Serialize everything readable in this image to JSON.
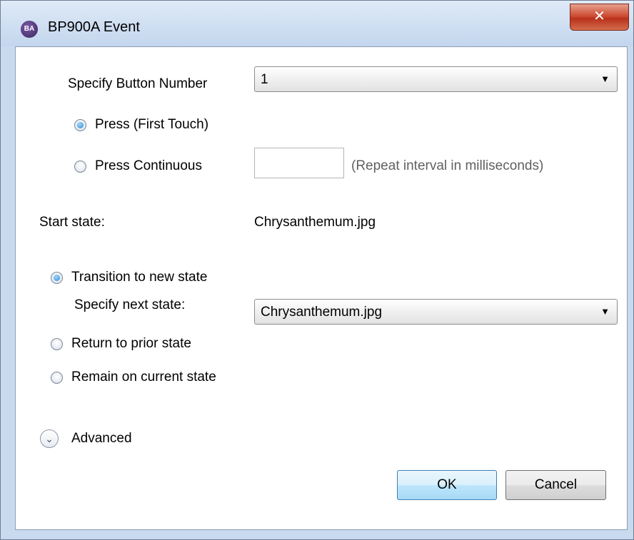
{
  "window": {
    "title": "BP900A Event",
    "icon_text": "BA",
    "close_glyph": "✕"
  },
  "button_number": {
    "label": "Specify Button Number",
    "value": "1",
    "arrow": "▼"
  },
  "press_mode": {
    "first_touch_label": "Press (First Touch)",
    "continuous_label": "Press Continuous",
    "selected": "first_touch",
    "interval_value": "",
    "interval_hint": "(Repeat interval in milliseconds)"
  },
  "start_state": {
    "label": "Start state:",
    "value": "Chrysanthemum.jpg"
  },
  "action": {
    "transition_label": "Transition to new state",
    "next_state_label": "Specify next state:",
    "next_state_value": "Chrysanthemum.jpg",
    "next_state_arrow": "▼",
    "return_label": "Return to prior state",
    "remain_label": "Remain on current state",
    "selected": "transition"
  },
  "advanced": {
    "label": "Advanced",
    "icon_glyph": "⌄"
  },
  "buttons": {
    "ok": "OK",
    "cancel": "Cancel"
  }
}
